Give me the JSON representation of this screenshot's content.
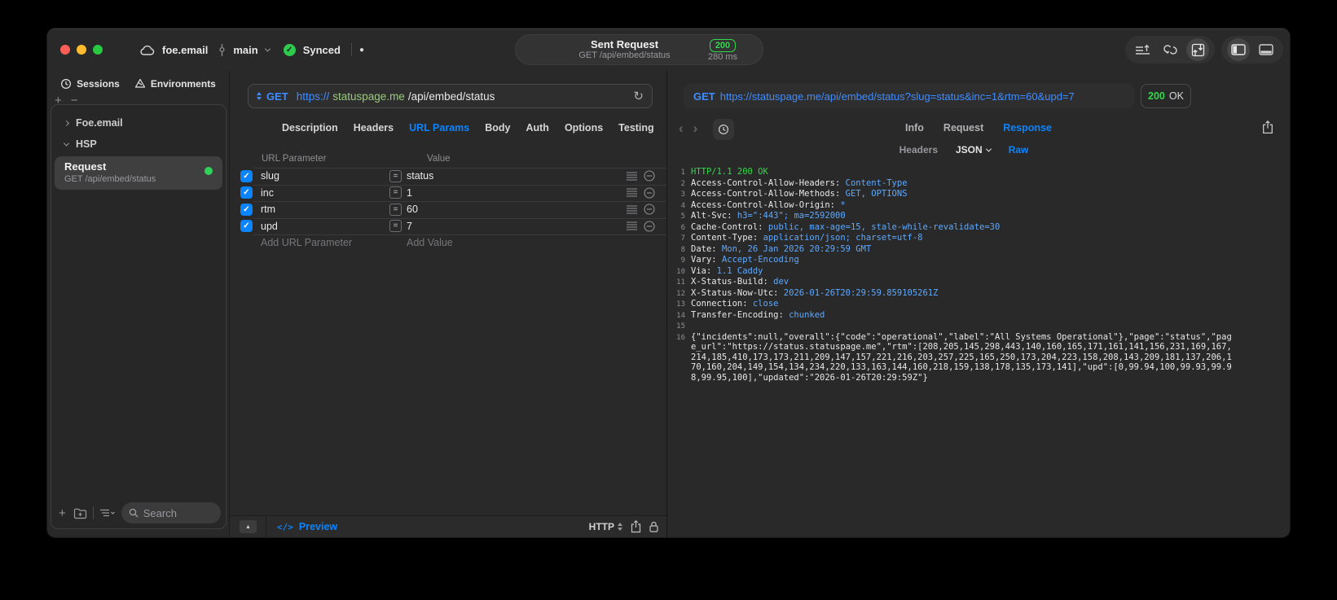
{
  "colors": {
    "accent": "#0a84ff",
    "success": "#32d74b",
    "url_host_green": "#9bc97f",
    "value_blue": "#5da9ff"
  },
  "icons": {
    "check": "✓",
    "equals": "=",
    "collapse_up": "▲",
    "nav_back": "‹",
    "nav_forward": "›",
    "refresh": "↻",
    "code": "</>",
    "plus": "+",
    "minus": "−",
    "dot": "●",
    "names": [
      "cloud-icon",
      "git-branch-icon",
      "synced-check-icon",
      "request-list-icon",
      "sync-loop-icon",
      "import-export-icon",
      "left-panel-icon",
      "bottom-panel-icon",
      "clock-icon",
      "environments-icon",
      "folder-add-icon",
      "sort-list-icon",
      "search-icon",
      "history-clock-icon",
      "share-icon",
      "lock-icon",
      "drag-lines-icon",
      "remove-circle-icon"
    ]
  },
  "titlebar": {
    "account": "foe.email",
    "branch": "main",
    "sync_label": "Synced",
    "center": {
      "title": "Sent Request",
      "subtitle": "GET /api/embed/status",
      "status": "200",
      "time": "280 ms"
    }
  },
  "sidebar": {
    "tab_sessions": "Sessions",
    "tab_environments": "Environments",
    "tree": [
      {
        "label": "Foe.email"
      },
      {
        "label": "HSP"
      }
    ],
    "request": {
      "title": "Request",
      "subtitle": "GET /api/embed/status"
    },
    "search_placeholder": "Search"
  },
  "editor": {
    "method": "GET",
    "url_scheme": "https://",
    "url_host": "statuspage.me",
    "url_path": "/api/embed/status",
    "tabs": [
      "Description",
      "Headers",
      "URL Params",
      "Body",
      "Auth",
      "Options",
      "Testing"
    ],
    "active_tab": "URL Params",
    "table": {
      "col_name": "URL Parameter",
      "col_value": "Value",
      "rows": [
        {
          "name": "slug",
          "value": "status",
          "enabled": true
        },
        {
          "name": "inc",
          "value": "1",
          "enabled": true
        },
        {
          "name": "rtm",
          "value": "60",
          "enabled": true
        },
        {
          "name": "upd",
          "value": "7",
          "enabled": true
        }
      ],
      "add_name": "Add URL Parameter",
      "add_value": "Add Value"
    },
    "footer": {
      "preview": "Preview",
      "protocol": "HTTP"
    }
  },
  "response": {
    "method": "GET",
    "url": "https://statuspage.me/api/embed/status?slug=status&inc=1&rtm=60&upd=7",
    "status_code": "200",
    "status_text": "OK",
    "tabs": [
      "Info",
      "Request",
      "Response"
    ],
    "active_tab": "Response",
    "subtab_headers": "Headers",
    "subtab_json": "JSON",
    "subtab_raw": "Raw",
    "active_subtab": "Raw",
    "raw_lines": [
      {
        "n": 1,
        "status": "HTTP/1.1 200 OK"
      },
      {
        "n": 2,
        "name": "Access-Control-Allow-Headers",
        "value": "Content-Type"
      },
      {
        "n": 3,
        "name": "Access-Control-Allow-Methods",
        "value": "GET, OPTIONS"
      },
      {
        "n": 4,
        "name": "Access-Control-Allow-Origin",
        "value": "*"
      },
      {
        "n": 5,
        "name": "Alt-Svc",
        "value": "h3=\":443\"; ma=2592000"
      },
      {
        "n": 6,
        "name": "Cache-Control",
        "value": "public, max-age=15, stale-while-revalidate=30"
      },
      {
        "n": 7,
        "name": "Content-Type",
        "value": "application/json; charset=utf-8"
      },
      {
        "n": 8,
        "name": "Date",
        "value": "Mon, 26 Jan 2026 20:29:59 GMT"
      },
      {
        "n": 9,
        "name": "Vary",
        "value": "Accept-Encoding"
      },
      {
        "n": 10,
        "name": "Via",
        "value": "1.1 Caddy"
      },
      {
        "n": 11,
        "name": "X-Status-Build",
        "value": "dev"
      },
      {
        "n": 12,
        "name": "X-Status-Now-Utc",
        "value": "2026-01-26T20:29:59.859105261Z"
      },
      {
        "n": 13,
        "name": "Connection",
        "value": "close"
      },
      {
        "n": 14,
        "name": "Transfer-Encoding",
        "value": "chunked"
      },
      {
        "n": 15
      },
      {
        "n": 16,
        "body": "{\"incidents\":null,\"overall\":{\"code\":\"operational\",\"label\":\"All Systems Operational\"},\"page\":\"status\",\"page_url\":\"https://status.statuspage.me\",\"rtm\":[208,205,145,298,443,140,160,165,171,161,141,156,231,169,167,214,185,410,173,173,211,209,147,157,221,216,203,257,225,165,250,173,204,223,158,208,143,209,181,137,206,170,160,204,149,154,134,234,220,133,163,144,160,218,159,138,178,135,173,141],\"upd\":[0,99.94,100,99.93,99.98,99.95,100],\"updated\":\"2026-01-26T20:29:59Z\"}"
      }
    ]
  }
}
